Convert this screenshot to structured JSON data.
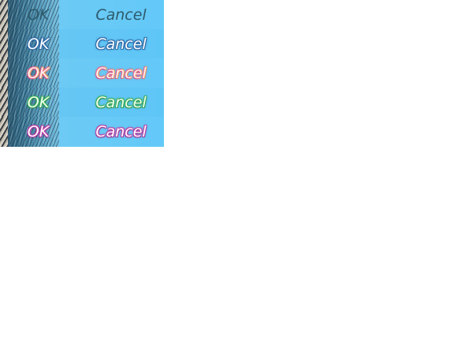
{
  "button_sheet": {
    "rows": [
      {
        "style": "normal",
        "ok_label": "OK",
        "cancel_label": "Cancel",
        "outline_color": "#2e5a6b"
      },
      {
        "style": "blue-outline",
        "ok_label": "OK",
        "cancel_label": "Cancel",
        "outline_color": "#2f6aa8"
      },
      {
        "style": "pink-outline",
        "ok_label": "OK",
        "cancel_label": "Cancel",
        "outline_color": "#e86a8e"
      },
      {
        "style": "green-outline",
        "ok_label": "OK",
        "cancel_label": "Cancel",
        "outline_color": "#39b05a"
      },
      {
        "style": "magenta-outline",
        "ok_label": "OK",
        "cancel_label": "Cancel",
        "outline_color": "#c03ea8"
      }
    ],
    "colors": {
      "cancel_background": "#63c9f8",
      "ok_background_dark": "#2b4f66",
      "ok_background_light": "#73bee0"
    }
  }
}
